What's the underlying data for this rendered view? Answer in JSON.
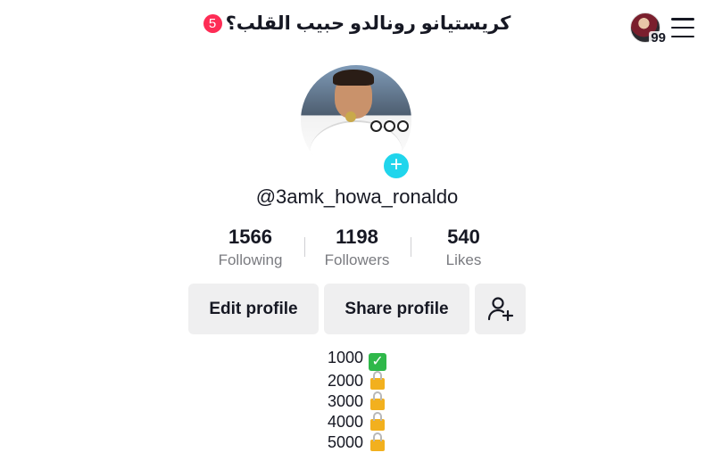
{
  "header": {
    "title": "كريستيانو رونالدو حبيب القلب؟",
    "notification_count": "5",
    "profile_views_count": "99"
  },
  "profile": {
    "username": "@3amk_howa_ronaldo"
  },
  "stats": [
    {
      "value": "1566",
      "label": "Following"
    },
    {
      "value": "1198",
      "label": "Followers"
    },
    {
      "value": "540",
      "label": "Likes"
    }
  ],
  "actions": {
    "edit_label": "Edit profile",
    "share_label": "Share profile"
  },
  "bio": {
    "lines": [
      {
        "text": "1000",
        "icon": "check-icon"
      },
      {
        "text": "2000",
        "icon": "lock-icon"
      },
      {
        "text": "3000",
        "icon": "lock-icon"
      },
      {
        "text": "4000",
        "icon": "lock-icon"
      },
      {
        "text": "5000",
        "icon": "lock-icon"
      }
    ]
  },
  "colors": {
    "accent_red": "#fe2c55",
    "add_story_cyan": "#20d5ec",
    "button_bg": "#efeff0",
    "check_green": "#2fb84a",
    "lock_yellow": "#f2b01e"
  }
}
